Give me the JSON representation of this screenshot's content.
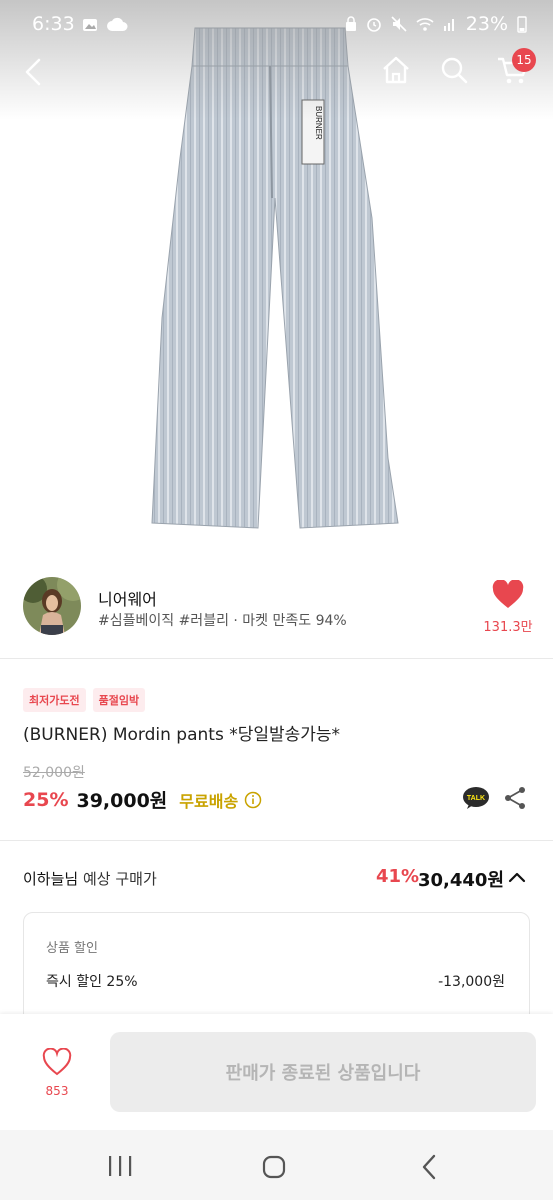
{
  "status_bar": {
    "time": "6:33",
    "battery": "23%"
  },
  "nav": {
    "cart_count": "15"
  },
  "product_image": {
    "tag_text": "BURNER"
  },
  "seller": {
    "name": "니어웨어",
    "tags": "#심플베이직 #러블리 · 마켓 만족도 94%",
    "like_count": "131.3만"
  },
  "badges": [
    "최저가도전",
    "품절임박"
  ],
  "product": {
    "title": "(BURNER) Mordin pants *당일발송가능*",
    "original_price": "52,000원",
    "discount_rate": "25%",
    "price": "39,000원",
    "free_shipping": "무료배송",
    "talk_label": "TALK"
  },
  "expected": {
    "user": "이하늘님",
    "label": "예상 구매가",
    "rate": "41%",
    "price": "30,440원"
  },
  "discount_detail": {
    "title": "상품 할인",
    "row_label": "즉시 할인 25%",
    "row_value": "-13,000원"
  },
  "action": {
    "wish_count": "853",
    "button_label": "판매가 종료된 상품입니다"
  },
  "colors": {
    "accent": "#e8474f",
    "shipping": "#c9a300"
  }
}
